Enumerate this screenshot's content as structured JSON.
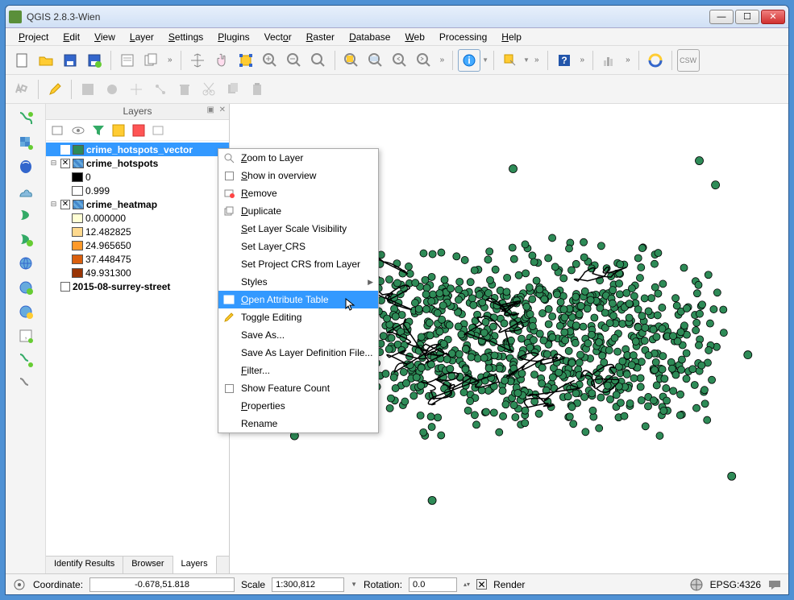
{
  "window": {
    "title": "QGIS 2.8.3-Wien"
  },
  "menus": [
    "Project",
    "Edit",
    "View",
    "Layer",
    "Settings",
    "Plugins",
    "Vector",
    "Raster",
    "Database",
    "Web",
    "Processing",
    "Help"
  ],
  "layers_panel": {
    "title": "Layers",
    "tabs": [
      "Identify Results",
      "Browser",
      "Layers"
    ],
    "active_tab": 2,
    "tree": [
      {
        "type": "layer",
        "label": "crime_hotspots_vector",
        "checked": true,
        "selected": true,
        "swatch": "#2e8b57",
        "indent": 0,
        "bold": true
      },
      {
        "type": "layer",
        "label": "crime_hotspots",
        "checked": true,
        "selected": false,
        "swatch": "pattern",
        "indent": 0,
        "bold": true,
        "expanded": true
      },
      {
        "type": "legend",
        "label": "0",
        "swatch": "#000000",
        "indent": 2
      },
      {
        "type": "legend",
        "label": "0.999",
        "swatch": "#ffffff",
        "indent": 2
      },
      {
        "type": "layer",
        "label": "crime_heatmap",
        "checked": true,
        "selected": false,
        "swatch": "pattern",
        "indent": 0,
        "bold": true,
        "expanded": true
      },
      {
        "type": "legend",
        "label": "0.000000",
        "swatch": "#ffffd4",
        "indent": 2
      },
      {
        "type": "legend",
        "label": "12.482825",
        "swatch": "#fed98e",
        "indent": 2
      },
      {
        "type": "legend",
        "label": "24.965650",
        "swatch": "#fe9929",
        "indent": 2
      },
      {
        "type": "legend",
        "label": "37.448475",
        "swatch": "#d95f0e",
        "indent": 2
      },
      {
        "type": "legend",
        "label": "49.931300",
        "swatch": "#993404",
        "indent": 2
      },
      {
        "type": "layer",
        "label": "2015-08-surrey-street",
        "checked": false,
        "selected": false,
        "swatch": "none",
        "indent": 0,
        "bold": true
      }
    ]
  },
  "context_menu": {
    "items": [
      {
        "label": "Zoom to Layer",
        "underline": 0,
        "icon": "zoom"
      },
      {
        "label": "Show in overview",
        "underline": 0,
        "icon": "checkbox"
      },
      {
        "label": "Remove",
        "underline": 0,
        "icon": "remove"
      },
      {
        "label": "Duplicate",
        "underline": 0,
        "icon": "duplicate"
      },
      {
        "label": "Set Layer Scale Visibility",
        "underline": 0
      },
      {
        "label": "Set Layer CRS",
        "underline": 9
      },
      {
        "label": "Set Project CRS from Layer"
      },
      {
        "label": "Styles",
        "submenu": true
      },
      {
        "label": "Open Attribute Table",
        "underline": 0,
        "icon": "table",
        "highlight": true
      },
      {
        "label": "Toggle Editing",
        "icon": "pencil"
      },
      {
        "label": "Save As..."
      },
      {
        "label": "Save As Layer Definition File..."
      },
      {
        "label": "Filter...",
        "underline": 0
      },
      {
        "label": "Show Feature Count",
        "icon": "checkbox"
      },
      {
        "label": "Properties",
        "underline": 0
      },
      {
        "label": "Rename"
      }
    ]
  },
  "statusbar": {
    "coord_label": "Coordinate:",
    "coord_value": "-0.678,51.818",
    "scale_label": "Scale",
    "scale_value": "1:300,812",
    "rotation_label": "Rotation:",
    "rotation_value": "0.0",
    "render_label": "Render",
    "crs": "EPSG:4326"
  },
  "map": {
    "fill": "#2e8b57",
    "stroke": "#000000"
  }
}
